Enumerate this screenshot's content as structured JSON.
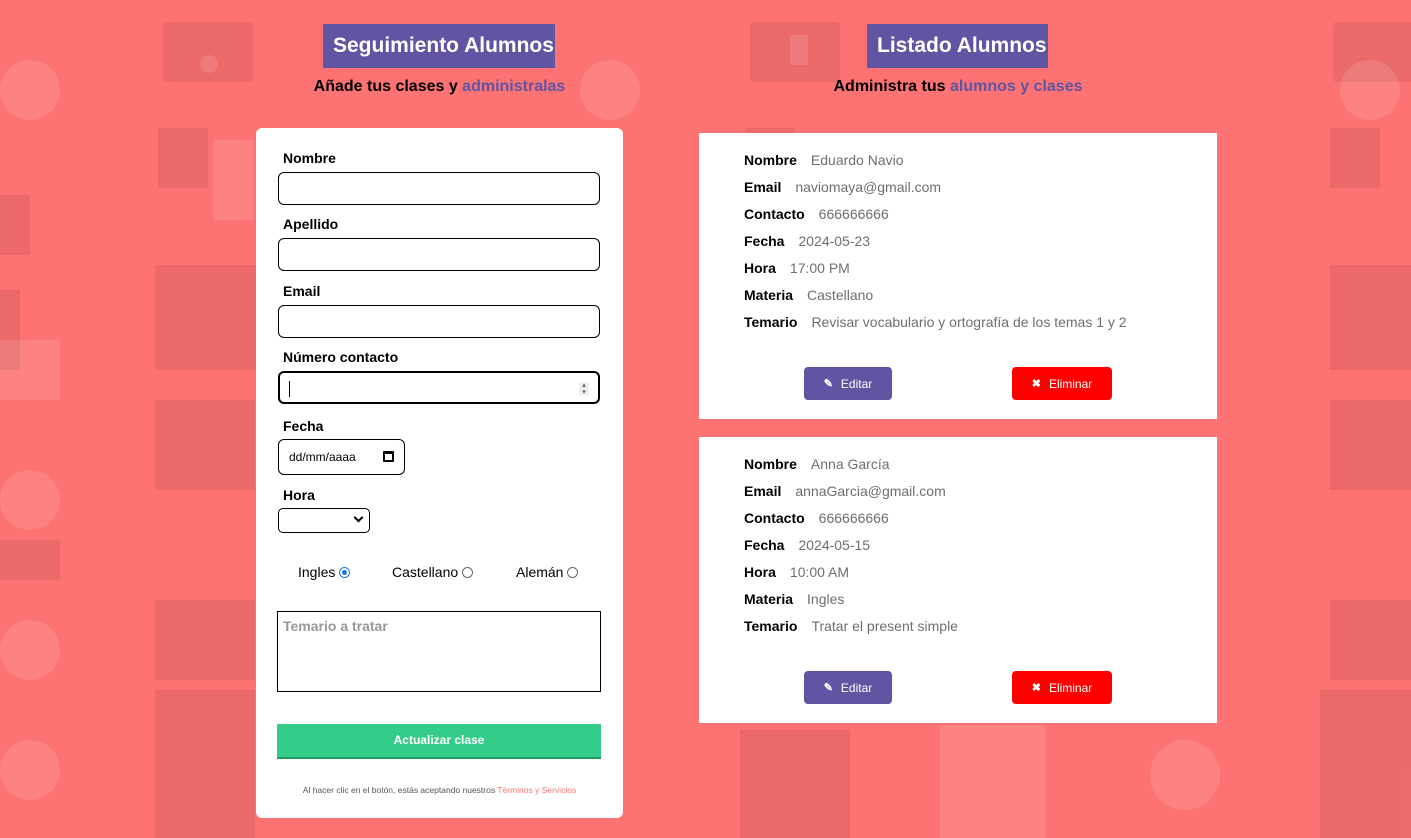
{
  "left": {
    "title": "Seguimiento Alumnos",
    "subtitle_a": "Añade tus clases y ",
    "subtitle_b": "administralas"
  },
  "right": {
    "title": "Listado Alumnos",
    "subtitle_a": "Administra tus ",
    "subtitle_b": "alumnos y clases"
  },
  "form": {
    "nombre_label": "Nombre",
    "apellido_label": "Apellido",
    "email_label": "Email",
    "contacto_label": "Número contacto",
    "fecha_label": "Fecha",
    "fecha_placeholder": "dd/mm/aaaa",
    "hora_label": "Hora",
    "radios": [
      {
        "label": "Ingles",
        "checked": true
      },
      {
        "label": "Castellano",
        "checked": false
      },
      {
        "label": "Alemán",
        "checked": false
      }
    ],
    "temario_placeholder": "Temario a tratar",
    "submit_label": "Actualizar clase",
    "terms_text": "Al hacer clic en el botón, estás aceptando nuestros ",
    "terms_link": "Términos y Servicios"
  },
  "labels": {
    "nombre": "Nombre",
    "email": "Email",
    "contacto": "Contacto",
    "fecha": "Fecha",
    "hora": "Hora",
    "materia": "Materia",
    "temario": "Temario",
    "edit": "Editar",
    "delete": "Eliminar"
  },
  "students": [
    {
      "nombre": "Eduardo Navio",
      "email": "naviomaya@gmail.com",
      "contacto": "666666666",
      "fecha": "2024-05-23",
      "hora": "17:00 PM",
      "materia": "Castellano",
      "temario": "Revisar vocabulario y ortografía de los temas 1 y 2"
    },
    {
      "nombre": "Anna García",
      "email": "annaGarcia@gmail.com",
      "contacto": "666666666",
      "fecha": "2024-05-15",
      "hora": "10:00 AM",
      "materia": "Ingles",
      "temario": "Tratar el present simple"
    }
  ],
  "colors": {
    "background": "#fd7272",
    "accent": "#5f55a3",
    "submit": "#33cc88",
    "delete": "#ff0000"
  },
  "icons": {
    "edit": "pencil-icon",
    "delete": "close-icon",
    "date": "calendar-icon",
    "select": "chevron-down-icon"
  }
}
